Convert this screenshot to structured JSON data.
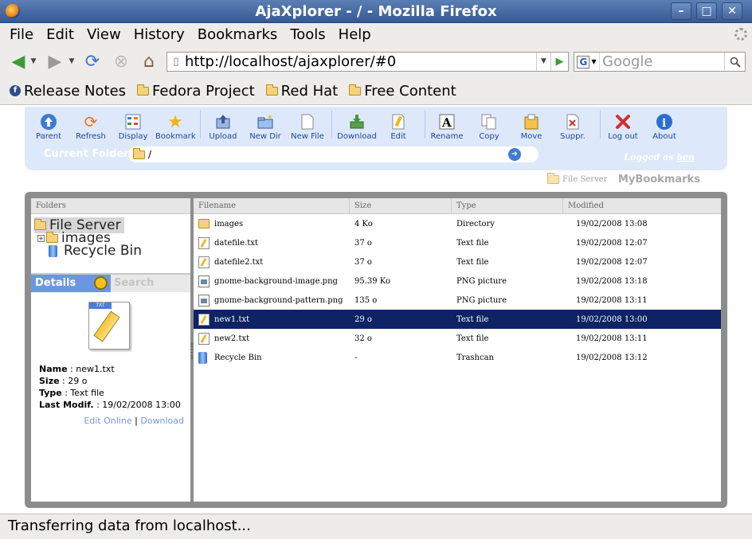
{
  "window": {
    "title": "AjaXplorer - / - Mozilla Firefox"
  },
  "menu": [
    "File",
    "Edit",
    "View",
    "History",
    "Bookmarks",
    "Tools",
    "Help"
  ],
  "navigation": {
    "url": "http://localhost/ajaxplorer/#0",
    "search_placeholder": "Google"
  },
  "bookmarks": [
    "Release Notes",
    "Fedora Project",
    "Red Hat",
    "Free Content"
  ],
  "toolbar": {
    "buttons": [
      "Parent",
      "Refresh",
      "Display",
      "Bookmark",
      "Upload",
      "New Dir",
      "New File",
      "Download",
      "Edit",
      "Rename",
      "Copy",
      "Move",
      "Suppr.",
      "Log out",
      "About"
    ],
    "current_folder_label": "Current Folder",
    "current_folder_value": "/",
    "logged_as_label": "Logged as",
    "logged_as_user": "ben"
  },
  "repository": {
    "name": "File Server",
    "bookmarks_label": "MyBookmarks"
  },
  "folders_panel": {
    "header": "Folders",
    "tree": [
      "File Server",
      "images",
      "Recycle Bin"
    ]
  },
  "details": {
    "title": "Details",
    "search_placeholder": "Search",
    "name_label": "Name",
    "name_value": "new1.txt",
    "size_label": "Size",
    "size_value": "29 o",
    "type_label": "Type",
    "type_value": "Text file",
    "modified_label": "Last Modif.",
    "modified_value": "19/02/2008 13:00",
    "edit_online": "Edit Online",
    "download": "Download",
    "link_separator": "|",
    "preview_tag": "TXT"
  },
  "file_list": {
    "columns": [
      "Filename",
      "Size",
      "Type",
      "Modified"
    ],
    "rows": [
      {
        "name": "images",
        "size": "4 Ko",
        "type": "Directory",
        "modified": "19/02/2008 13:08",
        "icon": "folder-icon"
      },
      {
        "name": "datefile.txt",
        "size": "37 o",
        "type": "Text file",
        "modified": "19/02/2008 12:07",
        "icon": "text-file-icon"
      },
      {
        "name": "datefile2.txt",
        "size": "37 o",
        "type": "Text file",
        "modified": "19/02/2008 12:07",
        "icon": "text-file-icon"
      },
      {
        "name": "gnome-background-image.png",
        "size": "95.39 Ko",
        "type": "PNG picture",
        "modified": "19/02/2008 13:18",
        "icon": "image-file-icon"
      },
      {
        "name": "gnome-background-pattern.png",
        "size": "135 o",
        "type": "PNG picture",
        "modified": "19/02/2008 13:11",
        "icon": "image-file-icon"
      },
      {
        "name": "new1.txt",
        "size": "29 o",
        "type": "Text file",
        "modified": "19/02/2008 13:00",
        "icon": "text-file-icon"
      },
      {
        "name": "new2.txt",
        "size": "32 o",
        "type": "Text file",
        "modified": "19/02/2008 13:11",
        "icon": "text-file-icon"
      },
      {
        "name": "Recycle Bin",
        "size": "-",
        "type": "Trashcan",
        "modified": "19/02/2008 13:12",
        "icon": "trash-icon"
      }
    ],
    "selected_row": 5
  },
  "status": {
    "text": "Transferring data from localhost..."
  },
  "colors": {
    "titlebar": "#355a94",
    "toolbar_panel": "#dde9fb",
    "selection": "#0d2364",
    "details_header": "#6a97e1",
    "link": "#7597d6"
  }
}
